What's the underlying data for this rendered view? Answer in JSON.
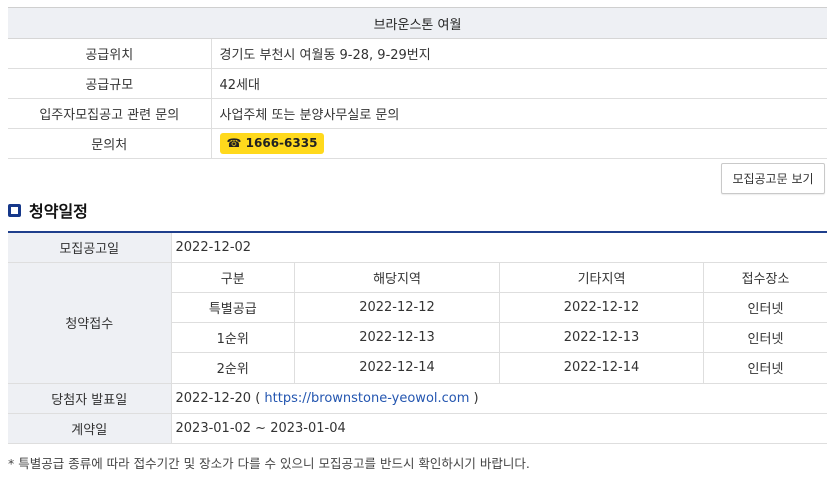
{
  "info": {
    "title": "브라운스톤 여월",
    "rows": [
      {
        "label": "공급위치",
        "value": "경기도 부천시 여월동 9-28, 9-29번지"
      },
      {
        "label": "공급규모",
        "value": "42세대"
      },
      {
        "label": "입주자모집공고 관련 문의",
        "value": "사업주체 또는 분양사무실로 문의"
      },
      {
        "label": "문의처",
        "value": "1666-6335"
      }
    ],
    "phone_icon": "☎"
  },
  "notice_button": "모집공고문 보기",
  "section": {
    "title": "청약일정"
  },
  "schedule": {
    "announce_label": "모집공고일",
    "announce_date": "2022-12-02",
    "apply_label": "청약접수",
    "headers": [
      "구분",
      "해당지역",
      "기타지역",
      "접수장소"
    ],
    "rows": [
      {
        "type": "특별공급",
        "local": "2022-12-12",
        "other": "2022-12-12",
        "place": "인터넷"
      },
      {
        "type": "1순위",
        "local": "2022-12-13",
        "other": "2022-12-13",
        "place": "인터넷"
      },
      {
        "type": "2순위",
        "local": "2022-12-14",
        "other": "2022-12-14",
        "place": "인터넷"
      }
    ],
    "winner_label": "당첨자 발표일",
    "winner_date": "2022-12-20",
    "winner_open": " ( ",
    "winner_link": "https://brownstone-yeowol.com",
    "winner_close": " )",
    "contract_label": "계약일",
    "contract_date": "2023-01-02 ~ 2023-01-04"
  },
  "footnote": "* 특별공급 종류에 따라 접수기간 및 장소가 다를 수 있으니 모집공고를 반드시 확인하시기 바랍니다."
}
